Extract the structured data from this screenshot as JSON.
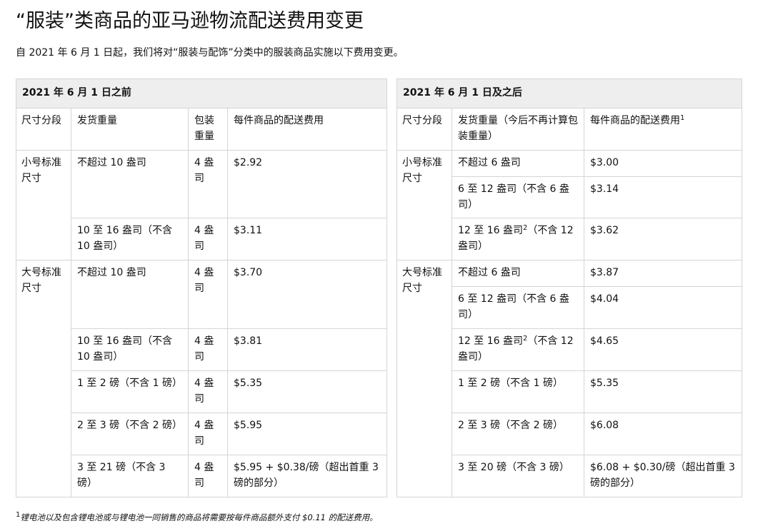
{
  "title": "“服装”类商品的亚马逊物流配送费用变更",
  "intro": "自 2021 年 6 月 1 日起，我们将对“服装与配饰”分类中的服装商品实施以下费用变更。",
  "before": {
    "header": "2021 年 6 月 1 日之前",
    "col_size": "尺寸分段",
    "col_weight": "发货重量",
    "col_pack": "包装重量",
    "col_fee": "每件商品的配送费用",
    "small_tier": "小号标准尺寸",
    "large_tier": "大号标准尺寸",
    "rows": [
      {
        "weight": "不超过 10 盎司",
        "pack": "4 盎司",
        "fee": "$2.92"
      },
      {
        "weight": "10 至 16 盎司（不含 10 盎司）",
        "pack": "4 盎司",
        "fee": "$3.11"
      },
      {
        "weight": "不超过 10 盎司",
        "pack": "4 盎司",
        "fee": "$3.70"
      },
      {
        "weight": "10 至 16 盎司（不含 10 盎司）",
        "pack": "4 盎司",
        "fee": "$3.81"
      },
      {
        "weight": "1 至 2 磅（不含 1 磅）",
        "pack": "4 盎司",
        "fee": "$5.35"
      },
      {
        "weight": "2 至 3 磅（不含 2 磅）",
        "pack": "4 盎司",
        "fee": "$5.95"
      },
      {
        "weight": "3 至 21 磅（不含 3 磅）",
        "pack": "4 盎司",
        "fee": "$5.95 + $0.38/磅（超出首重 3 磅的部分）"
      }
    ]
  },
  "after": {
    "header": "2021 年 6 月 1 日及之后",
    "col_size": "尺寸分段",
    "col_weight": "发货重量（今后不再计算包装重量）",
    "col_fee": "每件商品的配送费用",
    "col_fee_note": "1",
    "small_tier": "小号标准尺寸",
    "large_tier": "大号标准尺寸",
    "rows": [
      {
        "weight": "不超过 6 盎司",
        "note": "",
        "weight_rest": "",
        "fee": "$3.00"
      },
      {
        "weight": "6 至 12 盎司（不含 6 盎司）",
        "note": "",
        "weight_rest": "",
        "fee": "$3.14"
      },
      {
        "weight": "12 至 16 盎司",
        "note": "2",
        "weight_rest": "（不含 12 盎司）",
        "fee": "$3.62"
      },
      {
        "weight": "不超过 6 盎司",
        "note": "",
        "weight_rest": "",
        "fee": "$3.87"
      },
      {
        "weight": "6 至 12 盎司（不含 6 盎司）",
        "note": "",
        "weight_rest": "",
        "fee": "$4.04"
      },
      {
        "weight": "12 至 16 盎司",
        "note": "2",
        "weight_rest": "（不含 12 盎司）",
        "fee": "$4.65"
      },
      {
        "weight": "1 至 2 磅（不含 1 磅）",
        "note": "",
        "weight_rest": "",
        "fee": "$5.35"
      },
      {
        "weight": "2 至 3 磅（不含 2 磅）",
        "note": "",
        "weight_rest": "",
        "fee": "$6.08"
      },
      {
        "weight": "3 至 20 磅（不含 3 磅）",
        "note": "",
        "weight_rest": "",
        "fee": "$6.08 + $0.30/磅（超出首重 3 磅的部分）"
      }
    ]
  },
  "footnote": {
    "marker": "1",
    "text": "锂电池以及包含锂电池或与锂电池一同销售的商品将需要按每件商品额外支付 $0.11 的配送费用。"
  }
}
